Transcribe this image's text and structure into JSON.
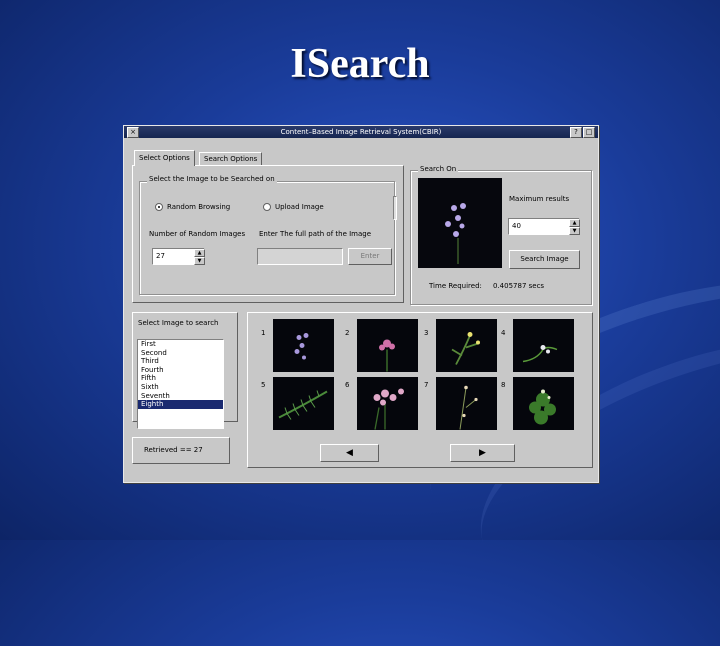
{
  "slide": {
    "title": "ISearch"
  },
  "window": {
    "title": "Content–Based Image Retrieval System(CBIR)",
    "close_glyph": "×",
    "help_glyph": "?",
    "maximize_glyph": "□"
  },
  "tabs": [
    {
      "label": "Select Options",
      "active": true
    },
    {
      "label": "Search Options",
      "active": false
    }
  ],
  "select_group": {
    "legend": "Select the Image to be Searched on",
    "radio_random": "Random Browsing",
    "radio_upload": "Upload Image",
    "num_random_label": "Number of Random Images",
    "num_random_value": "27",
    "path_label": "Enter The full path of the Image",
    "path_value": "",
    "enter_button": "Enter"
  },
  "search_group": {
    "legend": "Search On",
    "max_results_label": "Maximum results",
    "max_results_value": "40",
    "search_button": "Search Image",
    "time_label": "Time Required:",
    "time_value": "0.405787 secs"
  },
  "list_panel": {
    "label": "Select Image to search",
    "items": [
      "First",
      "Second",
      "Third",
      "Fourth",
      "Fifth",
      "Sixth",
      "Seventh",
      "Eighth"
    ],
    "selected_index": 7,
    "retrieved_text": "Retrieved == 27"
  },
  "results": {
    "numbers": [
      "1",
      "2",
      "3",
      "4",
      "5",
      "6",
      "7",
      "8"
    ],
    "prev_glyph": "◀",
    "next_glyph": "▶"
  },
  "colors": {
    "slide_background": "#1a3c9a",
    "titlebar": "#1a2a5a",
    "window_face": "#c8c8c8",
    "list_selection": "#1a2a70"
  },
  "icons": [
    "close-icon",
    "help-icon",
    "maximize-icon",
    "spin-up-icon",
    "spin-down-icon",
    "arrow-left-icon",
    "arrow-right-icon"
  ]
}
